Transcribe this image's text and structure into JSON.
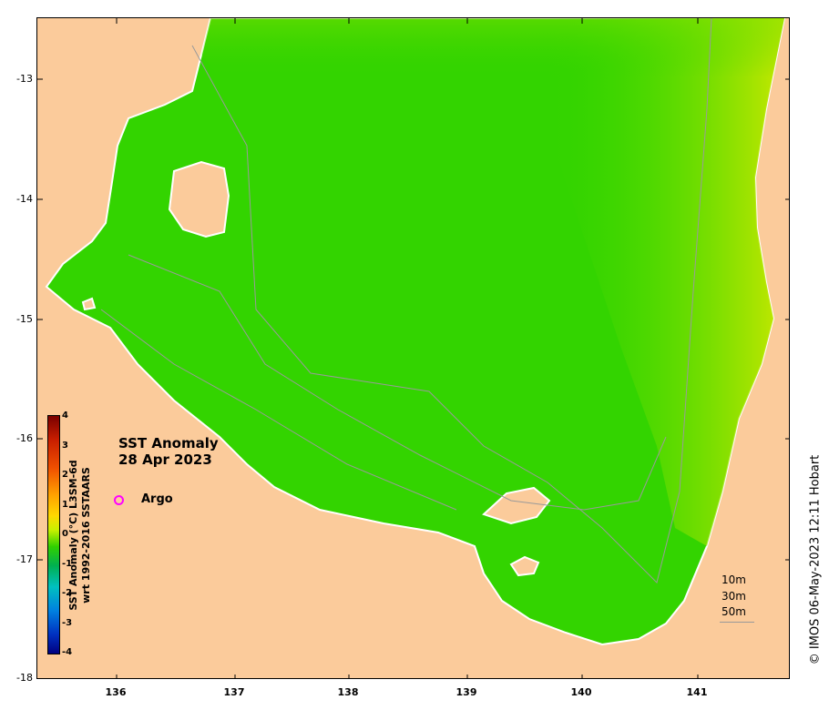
{
  "map": {
    "title_line1": "SST Anomaly",
    "title_line2": "28 Apr 2023",
    "legend_marker": "Argo",
    "y_ticks": [
      "-13",
      "-14",
      "-15",
      "-16",
      "-17",
      "-18"
    ],
    "x_ticks": [
      "136",
      "137",
      "138",
      "139",
      "140",
      "141"
    ],
    "colorbar": {
      "label_line1": "SST Anomaly (°C) L3SM-6d",
      "label_line2": "wrt 1992-2016 SSTAARS",
      "ticks": [
        "4",
        "3",
        "2",
        "1",
        "0",
        "-1",
        "-2",
        "-3",
        "-4"
      ],
      "range": [
        -4,
        4
      ]
    },
    "depth_contours": [
      "10m",
      "30m",
      "50m"
    ],
    "credit": "© IMOS 06-May-2023 12:11 Hobart",
    "colors": {
      "land": "#fbcb9b",
      "ocean_base": "#33d400",
      "ocean_warm": "#a6ea00",
      "argo": "#ff00ff"
    }
  }
}
